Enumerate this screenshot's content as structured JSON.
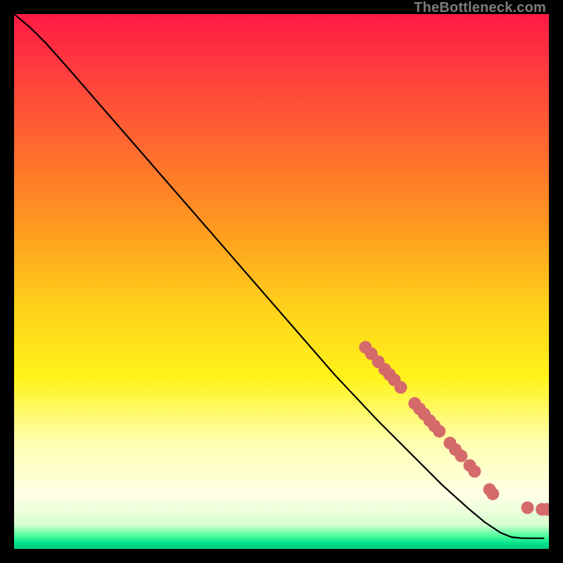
{
  "watermark": "TheBottleneck.com",
  "chart_data": {
    "type": "line",
    "title": "",
    "xlabel": "",
    "ylabel": "",
    "xlim": [
      0,
      100
    ],
    "ylim": [
      0,
      100
    ],
    "background_gradient": {
      "stops": [
        {
          "offset": 0.0,
          "color": "#ff1a44"
        },
        {
          "offset": 0.1,
          "color": "#ff3b3f"
        },
        {
          "offset": 0.25,
          "color": "#ff6a2f"
        },
        {
          "offset": 0.4,
          "color": "#ff9a1f"
        },
        {
          "offset": 0.55,
          "color": "#ffd21a"
        },
        {
          "offset": 0.68,
          "color": "#fff31a"
        },
        {
          "offset": 0.8,
          "color": "#ffffb0"
        },
        {
          "offset": 0.9,
          "color": "#ffffe6"
        },
        {
          "offset": 0.955,
          "color": "#d8ffd0"
        },
        {
          "offset": 0.975,
          "color": "#4eff9d"
        },
        {
          "offset": 0.99,
          "color": "#00e08b"
        },
        {
          "offset": 1.0,
          "color": "#00c87a"
        }
      ]
    },
    "curve": [
      {
        "x": 0.0,
        "y": 100.0
      },
      {
        "x": 3.0,
        "y": 97.5
      },
      {
        "x": 6.0,
        "y": 94.5
      },
      {
        "x": 10.0,
        "y": 90.0
      },
      {
        "x": 20.0,
        "y": 78.5
      },
      {
        "x": 30.0,
        "y": 67.0
      },
      {
        "x": 40.0,
        "y": 55.5
      },
      {
        "x": 50.0,
        "y": 44.0
      },
      {
        "x": 60.0,
        "y": 32.5
      },
      {
        "x": 68.0,
        "y": 24.0
      },
      {
        "x": 75.0,
        "y": 17.0
      },
      {
        "x": 80.0,
        "y": 12.0
      },
      {
        "x": 85.0,
        "y": 7.5
      },
      {
        "x": 88.0,
        "y": 5.0
      },
      {
        "x": 91.0,
        "y": 3.0
      },
      {
        "x": 93.0,
        "y": 2.2
      },
      {
        "x": 95.0,
        "y": 2.0
      },
      {
        "x": 97.0,
        "y": 2.0
      },
      {
        "x": 99.0,
        "y": 2.0
      }
    ],
    "scatter": {
      "color": "#d46a6a",
      "radius": 9,
      "points": [
        {
          "x": 65.7,
          "y": 37.7
        },
        {
          "x": 66.8,
          "y": 36.5
        },
        {
          "x": 68.1,
          "y": 35.0
        },
        {
          "x": 69.3,
          "y": 33.6
        },
        {
          "x": 70.2,
          "y": 32.6
        },
        {
          "x": 71.1,
          "y": 31.6
        },
        {
          "x": 72.3,
          "y": 30.2
        },
        {
          "x": 74.9,
          "y": 27.2
        },
        {
          "x": 75.8,
          "y": 26.2
        },
        {
          "x": 76.7,
          "y": 25.2
        },
        {
          "x": 77.7,
          "y": 24.0
        },
        {
          "x": 78.6,
          "y": 23.0
        },
        {
          "x": 79.5,
          "y": 22.0
        },
        {
          "x": 81.5,
          "y": 19.8
        },
        {
          "x": 82.5,
          "y": 18.6
        },
        {
          "x": 83.6,
          "y": 17.4
        },
        {
          "x": 85.2,
          "y": 15.6
        },
        {
          "x": 86.1,
          "y": 14.5
        },
        {
          "x": 88.9,
          "y": 11.1
        },
        {
          "x": 89.5,
          "y": 10.3
        },
        {
          "x": 96.0,
          "y": 7.7
        },
        {
          "x": 98.7,
          "y": 7.4
        },
        {
          "x": 99.6,
          "y": 7.4
        }
      ]
    }
  }
}
